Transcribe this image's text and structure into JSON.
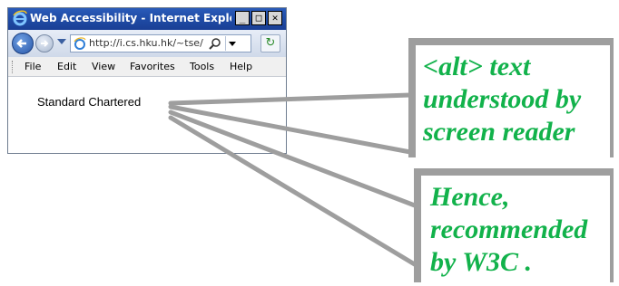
{
  "window": {
    "title": "Web Accessibility - Internet Explor...",
    "controls": {
      "minimize": "_",
      "maximize": "□",
      "close": "✕"
    }
  },
  "navbar": {
    "address": "http://i.cs.hku.hk/~tse/"
  },
  "menu": {
    "items": [
      "File",
      "Edit",
      "View",
      "Favorites",
      "Tools",
      "Help"
    ]
  },
  "page": {
    "text": "Standard Chartered"
  },
  "callouts": {
    "first": {
      "lines": [
        "<alt> text",
        "understood by",
        "screen reader"
      ]
    },
    "second": {
      "lines": [
        "Hence,",
        "recommended",
        "by W3C ."
      ]
    }
  },
  "colors": {
    "callout_text": "#12b24b",
    "titlebar": "#1e4aa4",
    "pointer": "#9e9e9e"
  }
}
